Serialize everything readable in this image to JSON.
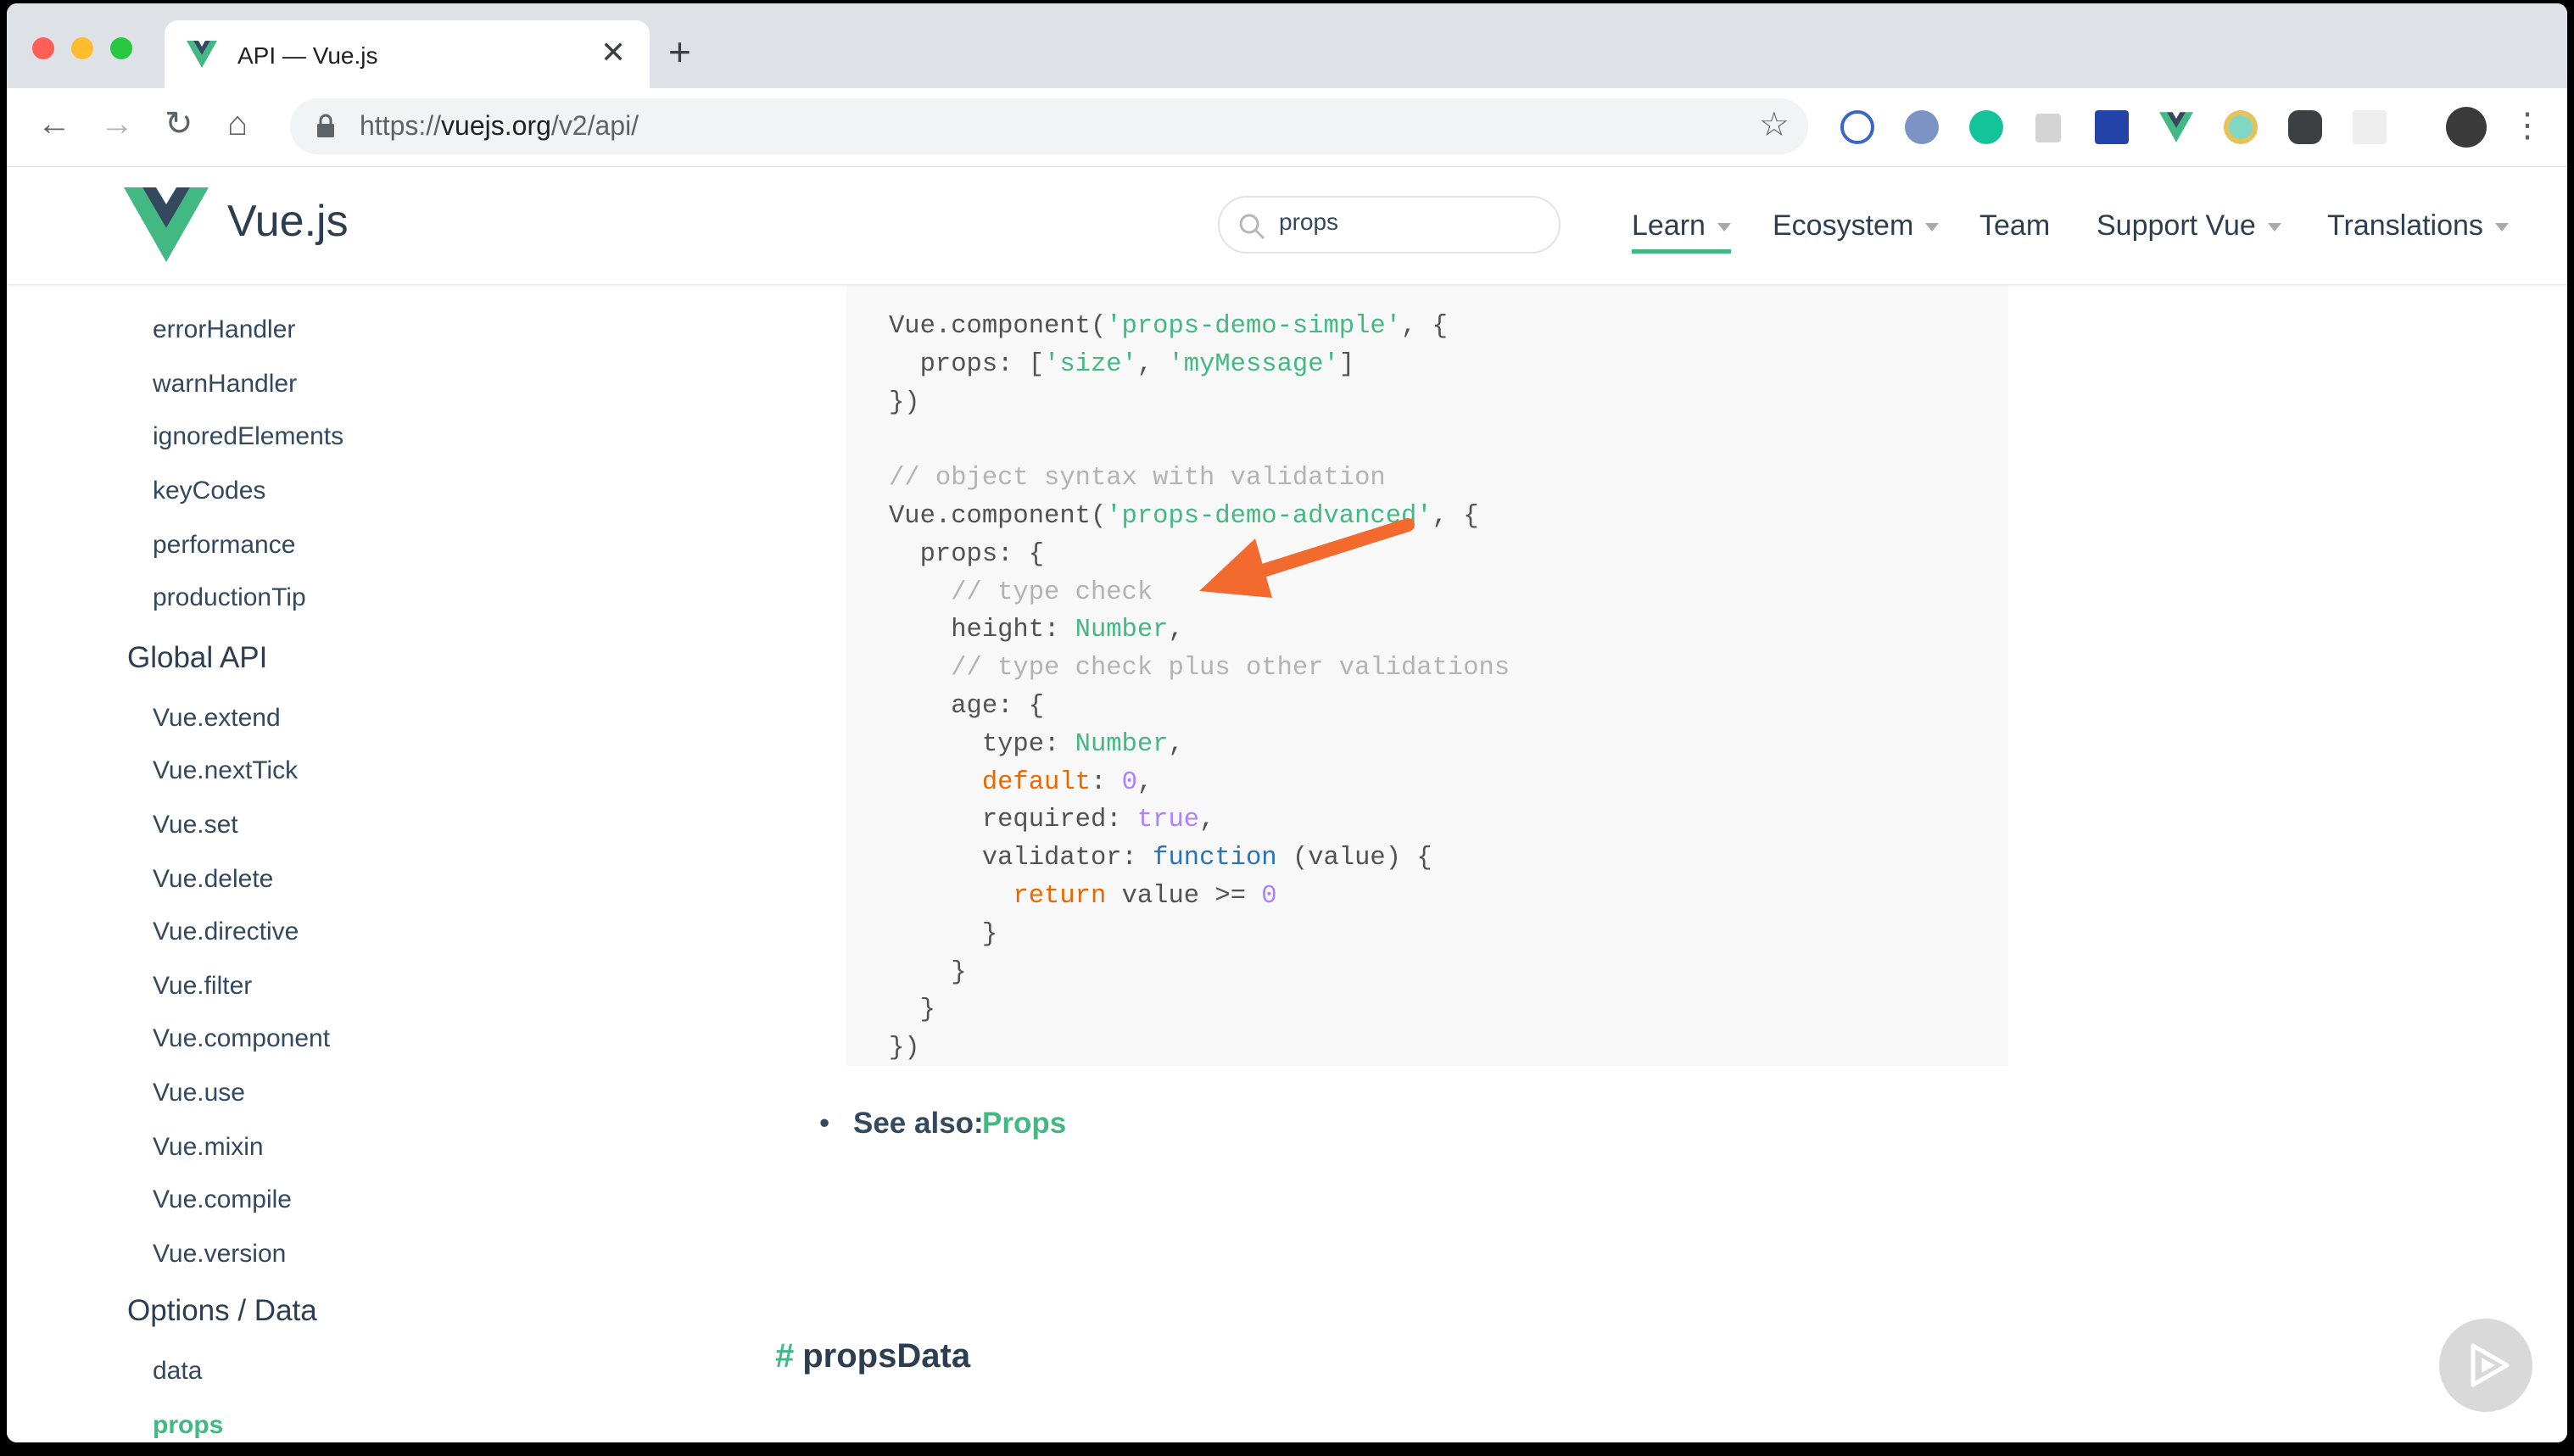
{
  "browser": {
    "tab_title": "API — Vue.js",
    "tab_close": "✕",
    "new_tab": "+",
    "nav_back": "←",
    "nav_forward": "→",
    "nav_reload": "↻",
    "nav_home": "⌂",
    "url_scheme": "https://",
    "url_host": "vuejs.org",
    "url_path": "/v2/api/",
    "bookmark_star": "☆",
    "menu": "⋮",
    "window_colors": [
      "#ff5f57",
      "#febc2e",
      "#28c840"
    ]
  },
  "site": {
    "brand": "Vue.js",
    "brand_color": "#42b983",
    "search_value": "props",
    "nav": [
      {
        "label": "Learn",
        "dropdown": true,
        "active": true
      },
      {
        "label": "Ecosystem",
        "dropdown": true
      },
      {
        "label": "Team",
        "dropdown": false
      },
      {
        "label": "Support Vue",
        "dropdown": true
      },
      {
        "label": "Translations",
        "dropdown": true
      }
    ]
  },
  "sidebar": {
    "config_items": [
      "errorHandler",
      "warnHandler",
      "ignoredElements",
      "keyCodes",
      "performance",
      "productionTip"
    ],
    "global_api_heading": "Global API",
    "global_api_items": [
      "Vue.extend",
      "Vue.nextTick",
      "Vue.set",
      "Vue.delete",
      "Vue.directive",
      "Vue.filter",
      "Vue.component",
      "Vue.use",
      "Vue.mixin",
      "Vue.compile",
      "Vue.version"
    ],
    "options_data_heading": "Options / Data",
    "options_data_items": [
      "data",
      "props"
    ],
    "active_item": "props"
  },
  "content": {
    "code_lines": [
      [
        [
          "Vue.component(",
          ""
        ],
        [
          "'props-demo-simple'",
          "str"
        ],
        [
          ", {",
          ""
        ]
      ],
      [
        [
          "  props: [",
          ""
        ],
        [
          "'size'",
          "str"
        ],
        [
          ", ",
          ""
        ],
        [
          "'myMessage'",
          "str"
        ],
        [
          "]",
          ""
        ]
      ],
      [
        [
          "})",
          ""
        ]
      ],
      [],
      [
        [
          "// object syntax with validation",
          "com"
        ]
      ],
      [
        [
          "Vue.component(",
          ""
        ],
        [
          "'props-demo-advanced'",
          "str"
        ],
        [
          ", {",
          ""
        ]
      ],
      [
        [
          "  props: {",
          ""
        ]
      ],
      [
        [
          "    // type check",
          "com"
        ]
      ],
      [
        [
          "    height: ",
          ""
        ],
        [
          "Number",
          "type"
        ],
        [
          ",",
          ""
        ]
      ],
      [
        [
          "    // type check plus other validations",
          "com"
        ]
      ],
      [
        [
          "    age: {",
          ""
        ]
      ],
      [
        [
          "      type: ",
          ""
        ],
        [
          "Number",
          "type"
        ],
        [
          ",",
          ""
        ]
      ],
      [
        [
          "      ",
          ""
        ],
        [
          "default",
          "kw"
        ],
        [
          ": ",
          ""
        ],
        [
          "0",
          "num"
        ],
        [
          ",",
          ""
        ]
      ],
      [
        [
          "      required: ",
          ""
        ],
        [
          "true",
          "num"
        ],
        [
          ",",
          ""
        ]
      ],
      [
        [
          "      validator: ",
          ""
        ],
        [
          "function",
          "fn"
        ],
        [
          " (value) {",
          ""
        ]
      ],
      [
        [
          "        ",
          ""
        ],
        [
          "return",
          "kw"
        ],
        [
          " value >= ",
          ""
        ],
        [
          "0",
          "num"
        ]
      ],
      [
        [
          "      }",
          ""
        ]
      ],
      [
        [
          "    }",
          ""
        ]
      ],
      [
        [
          "  }",
          ""
        ]
      ],
      [
        [
          "})",
          ""
        ]
      ]
    ],
    "see_also_label": "See also:",
    "see_also_link": "Props",
    "next_heading_hash": "#",
    "next_heading": "propsData"
  }
}
